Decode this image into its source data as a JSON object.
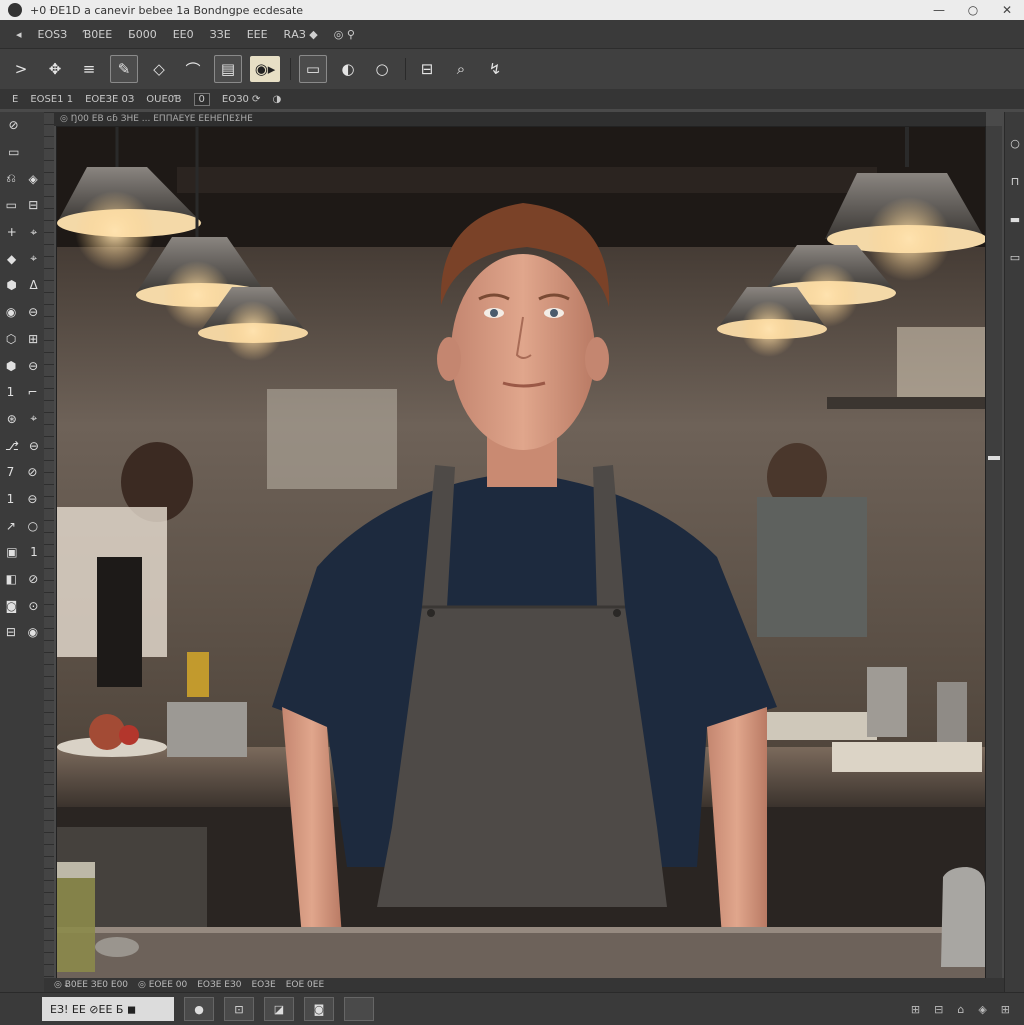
{
  "window": {
    "title": "+0 ÐE1D  a  canevir bebee 1a  Bondngpe ecdesate",
    "controls": [
      "—",
      "○",
      "✕"
    ]
  },
  "menubar": {
    "items": [
      "◂",
      "ЕОSЗ",
      "Ɓ0ЕЕ",
      "Б000",
      "ЕЕ0",
      "ЗЗЕ",
      "ЕЕЕ",
      "RАЗ ◆",
      "◎ ⚲"
    ]
  },
  "toolbar": {
    "tools": [
      {
        "name": "back-icon",
        "glyph": ">"
      },
      {
        "name": "move-icon",
        "glyph": "✥"
      },
      {
        "name": "menu-icon",
        "glyph": "≡"
      },
      {
        "name": "edit-icon",
        "glyph": "✎"
      },
      {
        "name": "tag-icon",
        "glyph": "◇"
      },
      {
        "name": "bell-icon",
        "glyph": "⌒"
      },
      {
        "name": "layers-icon",
        "glyph": "▤"
      },
      {
        "name": "media-icon",
        "glyph": "◉▸"
      },
      {
        "name": "frame-icon",
        "glyph": "▭"
      },
      {
        "name": "shape-icon",
        "glyph": "◐"
      },
      {
        "name": "circle-icon",
        "glyph": "○"
      },
      {
        "name": "crop-icon",
        "glyph": "⊟"
      },
      {
        "name": "search-icon",
        "glyph": "⌕"
      },
      {
        "name": "transform-icon",
        "glyph": "↯"
      }
    ]
  },
  "optionsbar": {
    "items": [
      "Е",
      "ЕОSЕ1 1",
      "ЕОЕЗЕ 0З",
      "ОUЕ0Ɓ",
      "0",
      "ЕОЗ0 ⟳",
      "◑"
    ]
  },
  "rulers": {
    "top_label": "◎ Ŋ00 ЕВ ɢɓ ЗНЕ ... ΕΠΠΑΕΥΕ ΕΕΗΕΠΕΣΗΕ"
  },
  "left_tools": [
    [
      "⊘",
      ""
    ],
    [
      "▭",
      ""
    ],
    [
      "⎌",
      "◈"
    ],
    [
      "▭",
      "⊟"
    ],
    [
      "+",
      "⌖"
    ],
    [
      "◆",
      "⌖"
    ],
    [
      "⬢",
      "ᐃ"
    ],
    [
      "◉",
      "⊖"
    ],
    [
      "⬡",
      "⊞"
    ],
    [
      "⬢",
      "⊖"
    ],
    [
      "1",
      "⌐"
    ],
    [
      "⊛",
      "⌖"
    ],
    [
      "⎇",
      "⊖"
    ],
    [
      "7",
      "⊘"
    ],
    [
      "1",
      "⊖"
    ],
    [
      "↗",
      "○"
    ],
    [
      "▣",
      "1"
    ],
    [
      "◧",
      "⊘"
    ],
    [
      "◙",
      "⊙"
    ],
    [
      "⊟",
      "◉"
    ]
  ],
  "right_panel": [
    "○",
    "⊓",
    "▬",
    "▭"
  ],
  "statusbar": {
    "items": [
      "◎ Ƀ0ЕЕ ЗЕ0 Е00",
      "◎ ЕОЕЕ 00",
      "ЕОЗЕ ЕЗ0",
      "ЕОЗЕ",
      "ЕОЕ 0ЕЕ"
    ]
  },
  "bottombar": {
    "field_text": "ЕЗ! ЕЕ ⊘ЕЕ   Б  ◼",
    "buttons": [
      "●",
      "⊡",
      "◪",
      "◙",
      ""
    ],
    "right_icons": [
      "⊞",
      "⊟",
      "⌂",
      "◈",
      "⊞"
    ]
  },
  "colors": {
    "chrome": "#3b3b3b",
    "titlebar": "#ececec",
    "accent_tool": "#e7dfc5"
  }
}
